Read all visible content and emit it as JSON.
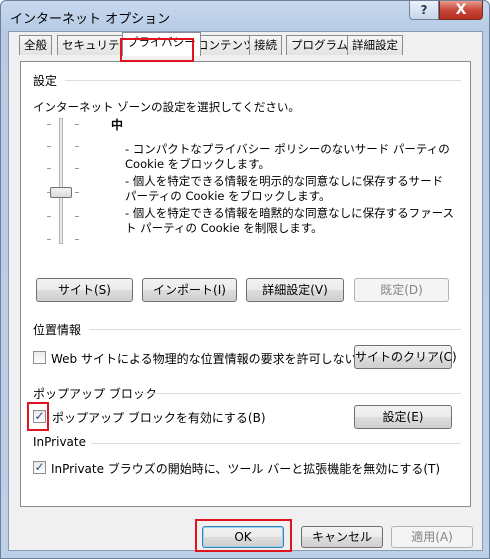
{
  "window": {
    "title": "インターネット オプション",
    "help_glyph": "?",
    "close_glyph": "X"
  },
  "tabs": [
    {
      "label": "全般"
    },
    {
      "label": "セキュリティ"
    },
    {
      "label": "プライバシー"
    },
    {
      "label": "コンテンツ"
    },
    {
      "label": "接続"
    },
    {
      "label": "プログラム"
    },
    {
      "label": "詳細設定"
    }
  ],
  "active_tab": "プライバシー",
  "settings": {
    "group_label": "設定",
    "instruction": "インターネット ゾーンの設定を選択してください。",
    "level_label": "中",
    "description_lines": [
      "- コンパクトなプライバシー ポリシーのないサード パーティの Cookie をブロックします。",
      "- 個人を特定できる情報を明示的な同意なしに保存するサード パーティの Cookie をブロックします。",
      "- 個人を特定できる情報を暗黙的な同意なしに保存するファースト パーティの Cookie を制限します。"
    ],
    "buttons": {
      "sites": "サイト(S)",
      "import": "インポート(I)",
      "advanced": "詳細設定(V)",
      "default": "既定(D)"
    }
  },
  "location": {
    "group_label": "位置情報",
    "checkbox_label": "Web サイトによる物理的な位置情報の要求を許可しない(L)",
    "checked": false,
    "clear_button": "サイトのクリア(C)"
  },
  "popup": {
    "group_label": "ポップアップ ブロック",
    "checkbox_label": "ポップアップ ブロックを有効にする(B)",
    "checked": true,
    "settings_button": "設定(E)"
  },
  "inprivate": {
    "group_label": "InPrivate",
    "checkbox_label": "InPrivate ブラウズの開始時に、ツール バーと拡張機能を無効にする(T)",
    "checked": true
  },
  "footer": {
    "ok": "OK",
    "cancel": "キャンセル",
    "apply": "適用(A)"
  },
  "check_glyph": "✓",
  "colors": {
    "highlight_box": "#e0141e",
    "title_bar": "#c8d9ee",
    "close_button": "#c7483a"
  }
}
